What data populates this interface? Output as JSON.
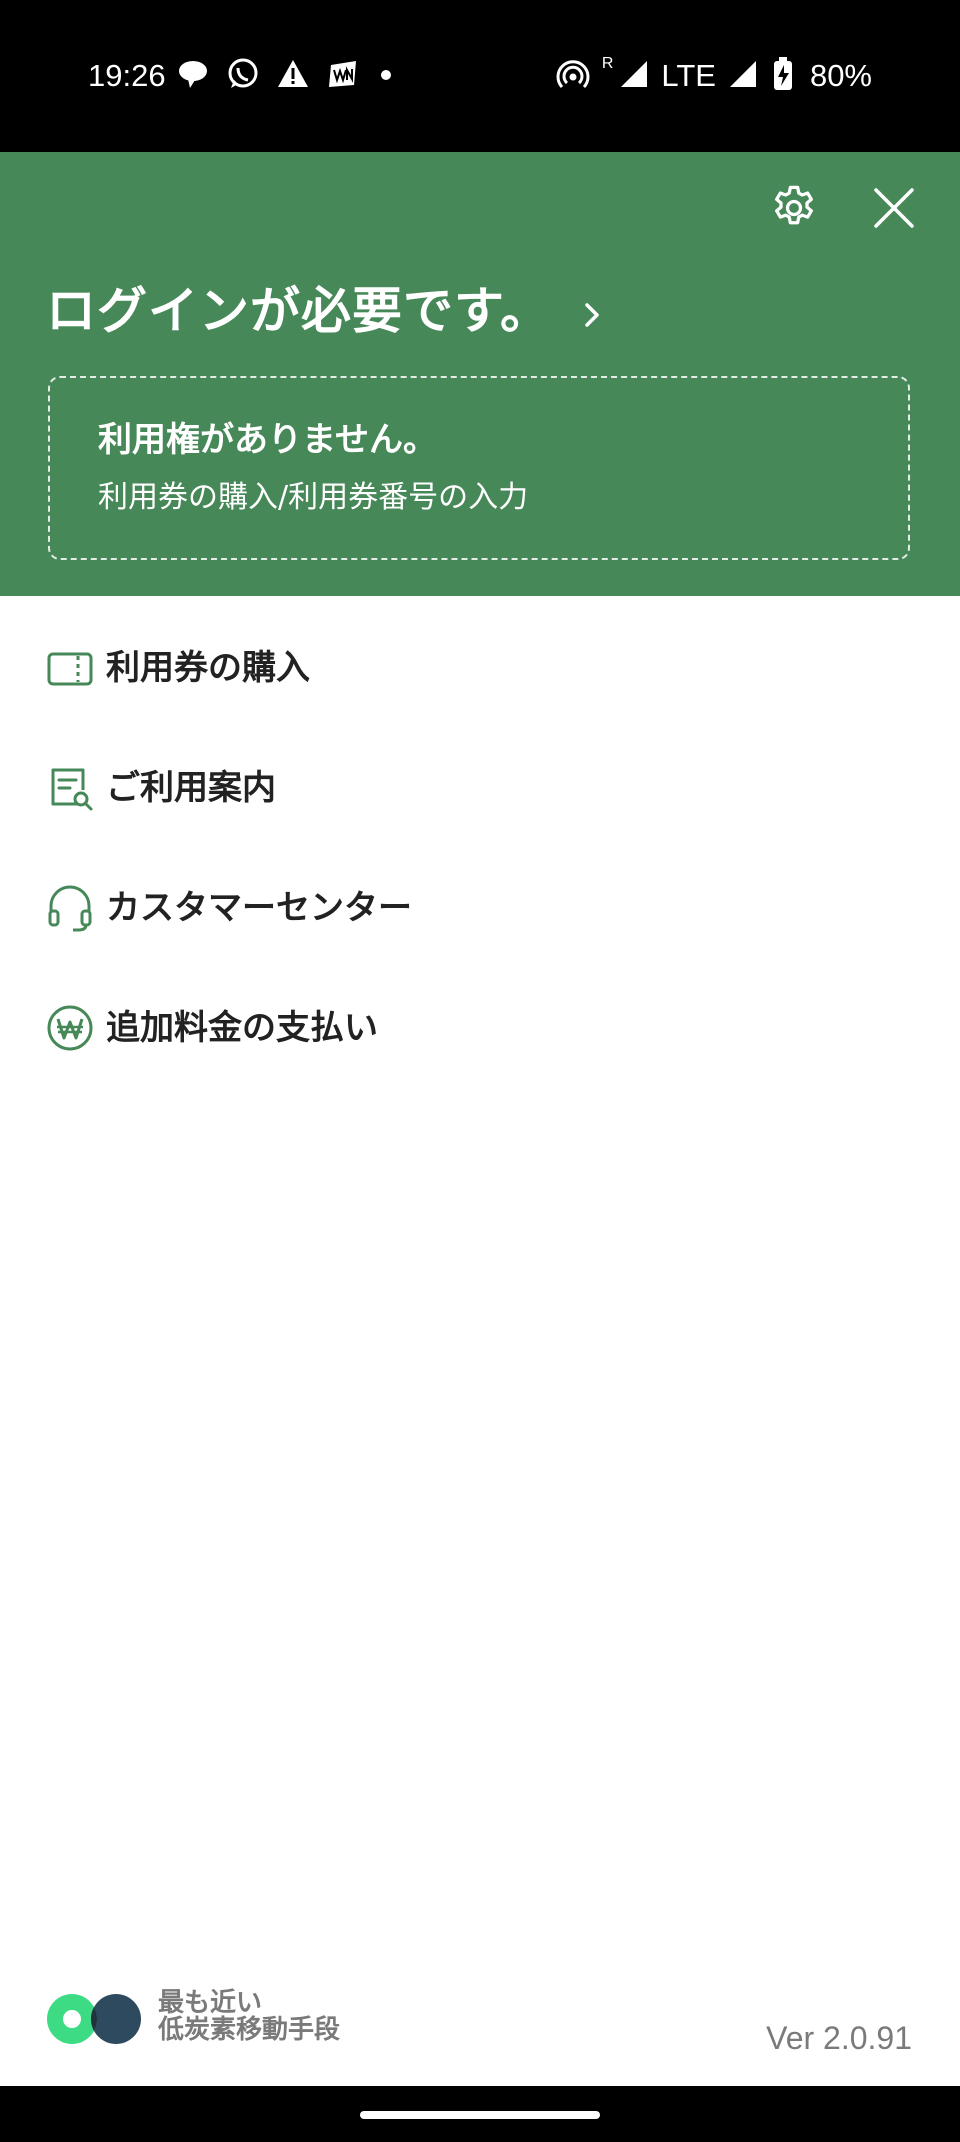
{
  "status_bar": {
    "time": "19:26",
    "network": "LTE",
    "roaming": "R",
    "battery": "80%"
  },
  "header": {
    "login_title": "ログインが必要です。",
    "ticket_title": "利用権がありません。",
    "ticket_subtitle": "利用券の購入/利用券番号の入力"
  },
  "menu": {
    "items": [
      {
        "label": "利用券の購入",
        "icon": "ticket-icon"
      },
      {
        "label": "ご利用案内",
        "icon": "guide-document-icon"
      },
      {
        "label": "カスタマーセンター",
        "icon": "headset-icon"
      },
      {
        "label": "追加料金の支払い",
        "icon": "won-coin-icon"
      }
    ]
  },
  "footer": {
    "tagline_line1": "最も近い",
    "tagline_line2": "低炭素移動手段",
    "version": "Ver 2.0.91"
  },
  "colors": {
    "header_green": "#478858",
    "icon_green": "#478858",
    "logo_green": "#3ddc84",
    "logo_navy": "#2e4a5e",
    "footer_gray": "#7a7a7a"
  }
}
